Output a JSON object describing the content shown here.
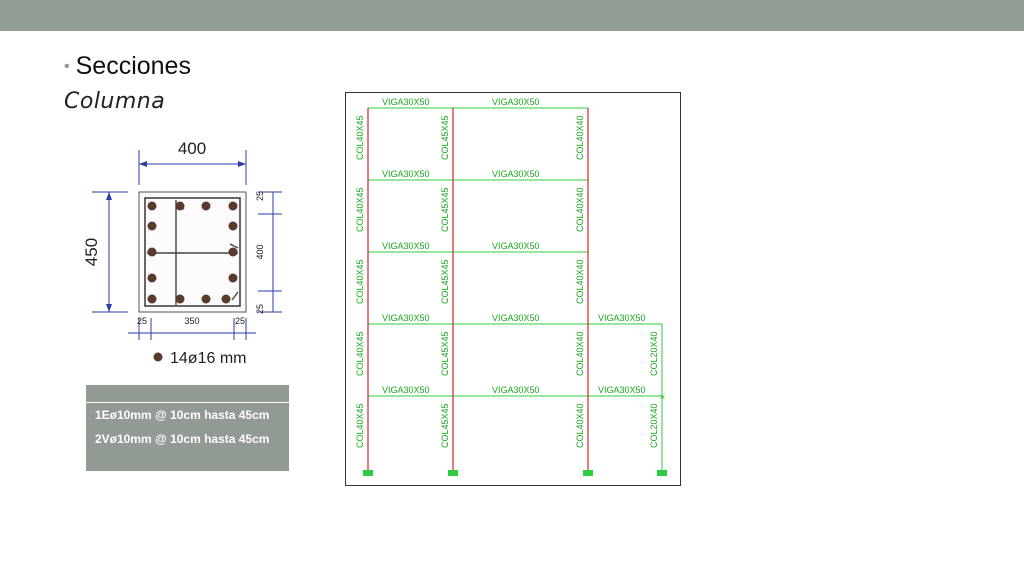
{
  "slide": {
    "bullet_text": "Secciones",
    "subtitle": "Columna"
  },
  "section": {
    "width_label": "400",
    "height_label": "450",
    "right_dims": [
      "25",
      "400",
      "25"
    ],
    "bottom_dims": [
      "25",
      "350",
      "25"
    ],
    "rebar_legend": "14ø16 mm"
  },
  "stirrups": {
    "line1": "1Eø10mm @ 10cm hasta 45cm",
    "line2": "2Vø10mm @ 10cm hasta 45cm"
  },
  "frame": {
    "beam_label": "VIGA30X50",
    "col_labels": [
      "COL40X45",
      "COL45X45",
      "COL40X40",
      "COL20X40"
    ],
    "colors": {
      "beam": "#2ecc40",
      "column": "#e02020",
      "text": "#1aa81a"
    }
  }
}
